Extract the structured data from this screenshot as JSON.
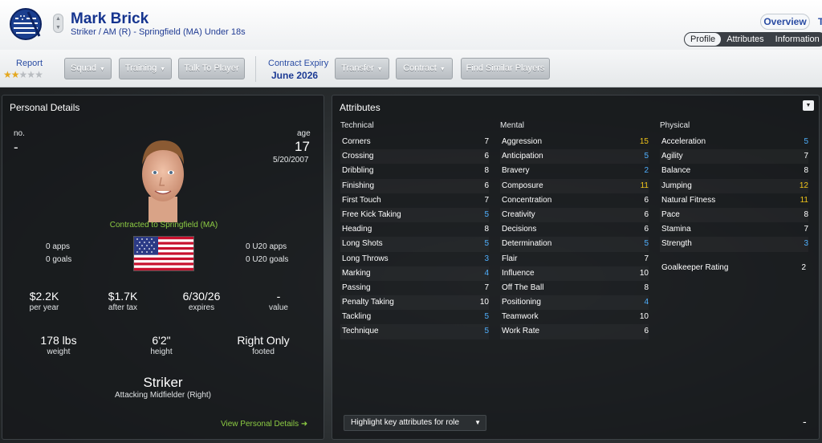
{
  "header": {
    "name": "Mark Brick",
    "subtitle": "Striker / AM (R) - Springfield (MA) Under 18s",
    "tab_overview": "Overview",
    "tab_overflow": "T",
    "subtabs": [
      "Profile",
      "Attributes",
      "Information"
    ],
    "active_subtab": "Profile"
  },
  "toolbar": {
    "report_label": "Report",
    "report_stars": 2,
    "report_stars_max": 5,
    "squad": "Squad",
    "training": "Training",
    "talk": "Talk To Player",
    "expiry_label": "Contract Expiry",
    "expiry_value": "June 2026",
    "transfer": "Transfer",
    "contract": "Contract",
    "similar": "Find Similar Players"
  },
  "personal": {
    "title": "Personal Details",
    "no_label": "no.",
    "no_value": "-",
    "age_label": "age",
    "age_value": "17",
    "dob": "5/20/2007",
    "contracted": "Contracted to Springfield (MA)",
    "apps": "0 apps",
    "goals": "0 goals",
    "u20_apps": "0 U20 apps",
    "u20_goals": "0 U20 goals",
    "wage_value": "$2.2K",
    "wage_label": "per year",
    "tax_value": "$1.7K",
    "tax_label": "after tax",
    "expires_value": "6/30/26",
    "expires_label": "expires",
    "value_value": "-",
    "value_label": "value",
    "weight_value": "178 lbs",
    "weight_label": "weight",
    "height_value": "6'2\"",
    "height_label": "height",
    "foot_value": "Right Only",
    "foot_label": "footed",
    "position": "Striker",
    "position_sub": "Attacking Midfielder (Right)",
    "view_details": "View Personal Details"
  },
  "attributes": {
    "title": "Attributes",
    "technical_title": "Technical",
    "technical": [
      {
        "name": "Corners",
        "value": "7"
      },
      {
        "name": "Crossing",
        "value": "6"
      },
      {
        "name": "Dribbling",
        "value": "8"
      },
      {
        "name": "Finishing",
        "value": "6"
      },
      {
        "name": "First Touch",
        "value": "7"
      },
      {
        "name": "Free Kick Taking",
        "value": "5"
      },
      {
        "name": "Heading",
        "value": "8"
      },
      {
        "name": "Long Shots",
        "value": "5"
      },
      {
        "name": "Long Throws",
        "value": "3"
      },
      {
        "name": "Marking",
        "value": "4"
      },
      {
        "name": "Passing",
        "value": "7"
      },
      {
        "name": "Penalty Taking",
        "value": "10"
      },
      {
        "name": "Tackling",
        "value": "5"
      },
      {
        "name": "Technique",
        "value": "5"
      }
    ],
    "mental_title": "Mental",
    "mental": [
      {
        "name": "Aggression",
        "value": "15"
      },
      {
        "name": "Anticipation",
        "value": "5"
      },
      {
        "name": "Bravery",
        "value": "2"
      },
      {
        "name": "Composure",
        "value": "11"
      },
      {
        "name": "Concentration",
        "value": "6"
      },
      {
        "name": "Creativity",
        "value": "6"
      },
      {
        "name": "Decisions",
        "value": "6"
      },
      {
        "name": "Determination",
        "value": "5"
      },
      {
        "name": "Flair",
        "value": "7"
      },
      {
        "name": "Influence",
        "value": "10"
      },
      {
        "name": "Off The Ball",
        "value": "8"
      },
      {
        "name": "Positioning",
        "value": "4"
      },
      {
        "name": "Teamwork",
        "value": "10"
      },
      {
        "name": "Work Rate",
        "value": "6"
      }
    ],
    "physical_title": "Physical",
    "physical": [
      {
        "name": "Acceleration",
        "value": "5"
      },
      {
        "name": "Agility",
        "value": "7"
      },
      {
        "name": "Balance",
        "value": "8"
      },
      {
        "name": "Jumping",
        "value": "12"
      },
      {
        "name": "Natural Fitness",
        "value": "11"
      },
      {
        "name": "Pace",
        "value": "8"
      },
      {
        "name": "Stamina",
        "value": "7"
      },
      {
        "name": "Strength",
        "value": "3"
      }
    ],
    "gk_label": "Goalkeeper Rating",
    "gk_value": "2",
    "highlight_select": "Highlight key attributes for role",
    "dash": "-"
  },
  "colors": {
    "low": "#4fb0ff",
    "mid": "#ffffff",
    "high": "#f0c419",
    "accent": "#8ccb43"
  }
}
